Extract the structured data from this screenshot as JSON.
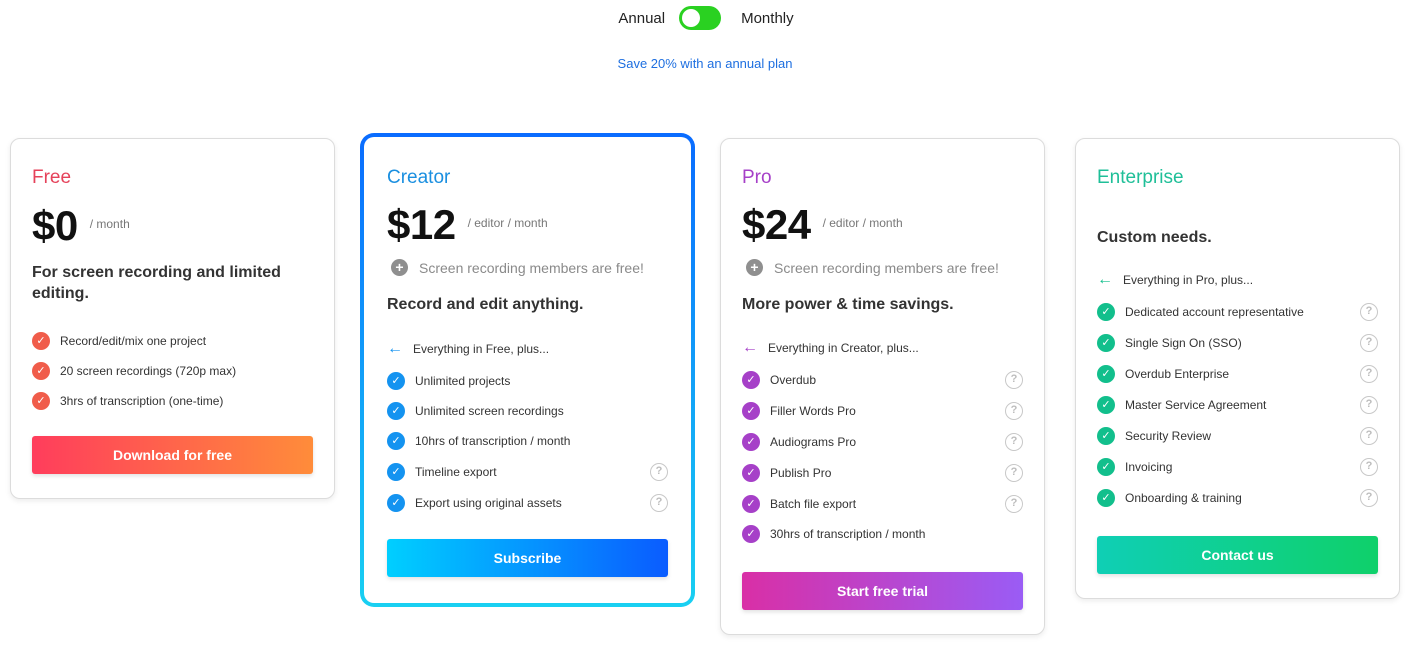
{
  "billing": {
    "annual_label": "Annual",
    "monthly_label": "Monthly",
    "selected": "Monthly",
    "toggle_color": "#2ad121",
    "save_note": "Save 20% with an annual plan"
  },
  "plans": [
    {
      "name": "Free",
      "name_color": "#e5425a",
      "price": "$0",
      "per": "/ month",
      "tagline": "For screen recording and limited editing.",
      "check_color": "#f05c4a",
      "features": [
        {
          "label": "Record/edit/mix one project"
        },
        {
          "label": "20 screen recordings (720p max)"
        },
        {
          "label": "3hrs of transcription (one-time)"
        }
      ],
      "cta": "Download for free",
      "cta_gradient": [
        "#ff3d5c",
        "#ff8c3a"
      ]
    },
    {
      "name": "Creator",
      "name_color": "#1a8fe0",
      "price": "$12",
      "per": "/ editor / month",
      "free_members": "Screen recording members are free!",
      "tagline": "Record and edit anything.",
      "plus_line": "Everything in Free, plus...",
      "accent_color": "#1493f0",
      "check_color": "#1493f0",
      "features": [
        {
          "label": "Unlimited projects",
          "help": false
        },
        {
          "label": "Unlimited screen recordings",
          "help": false
        },
        {
          "label": "10hrs of transcription / month",
          "help": false
        },
        {
          "label": "Timeline export",
          "help": true
        },
        {
          "label": "Export using original assets",
          "help": true
        }
      ],
      "cta": "Subscribe",
      "cta_gradient": [
        "#00cfff",
        "#0a5cff"
      ],
      "featured": true
    },
    {
      "name": "Pro",
      "name_color": "#a640c8",
      "price": "$24",
      "per": "/ editor / month",
      "free_members": "Screen recording members are free!",
      "tagline": "More power & time savings.",
      "plus_line": "Everything in Creator, plus...",
      "accent_color": "#a640c8",
      "check_color": "#a640c8",
      "features": [
        {
          "label": "Overdub",
          "help": true
        },
        {
          "label": "Filler Words Pro",
          "help": true
        },
        {
          "label": "Audiograms Pro",
          "help": true
        },
        {
          "label": "Publish Pro",
          "help": true
        },
        {
          "label": "Batch file export",
          "help": true
        },
        {
          "label": "30hrs of transcription / month",
          "help": false
        }
      ],
      "cta": "Start free trial",
      "cta_gradient": [
        "#d92fa6",
        "#9a5cf5"
      ]
    },
    {
      "name": "Enterprise",
      "name_color": "#1fbf98",
      "tagline": "Custom needs.",
      "plus_line": "Everything in Pro, plus...",
      "accent_color": "#12bf8c",
      "check_color": "#12bf8c",
      "features": [
        {
          "label": "Dedicated account representative",
          "help": true
        },
        {
          "label": "Single Sign On (SSO)",
          "help": true
        },
        {
          "label": "Overdub Enterprise",
          "help": true
        },
        {
          "label": "Master Service Agreement",
          "help": true
        },
        {
          "label": "Security Review",
          "help": true
        },
        {
          "label": "Invoicing",
          "help": true
        },
        {
          "label": "Onboarding & training",
          "help": true
        }
      ],
      "cta": "Contact us",
      "cta_gradient": [
        "#0fcfb5",
        "#0fd06a"
      ]
    }
  ]
}
